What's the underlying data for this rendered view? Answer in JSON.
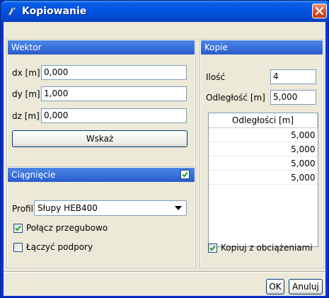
{
  "window": {
    "title": "Kopiowanie",
    "icon": "copy-app-icon"
  },
  "wektor": {
    "header": "Wektor",
    "dx_label": "dx [m]",
    "dx_value": "0,000",
    "dy_label": "dy [m]",
    "dy_value": "1,000",
    "dz_label": "dz [m]",
    "dz_value": "0,000",
    "wskaz_label": "Wskaż"
  },
  "ciagniecie": {
    "header": "Ciągnięcie",
    "enabled": true,
    "profil_label": "Profil",
    "profil_value": "Słupy HEB400",
    "polacz_label": "Połącz przegubowo",
    "polacz_checked": true,
    "laczyc_label": "Łączyć podpory",
    "laczyc_checked": false
  },
  "kopie": {
    "header": "Kopie",
    "ilosc_label": "Ilość",
    "ilosc_value": "4",
    "odleglosc_label": "Odległość [m]",
    "odleglosc_value": "5,000",
    "table_header": "Odległości [m]",
    "rows": [
      "5,000",
      "5,000",
      "5,000",
      "5,000"
    ],
    "kopiuj_label": "Kopiuj z obciążeniami",
    "kopiuj_checked": true
  },
  "buttons": {
    "ok": "OK",
    "cancel": "Anuluj"
  },
  "colors": {
    "header_blue": "#2a5ccc",
    "title_blue": "#0054e3",
    "close_red": "#d6532f"
  }
}
